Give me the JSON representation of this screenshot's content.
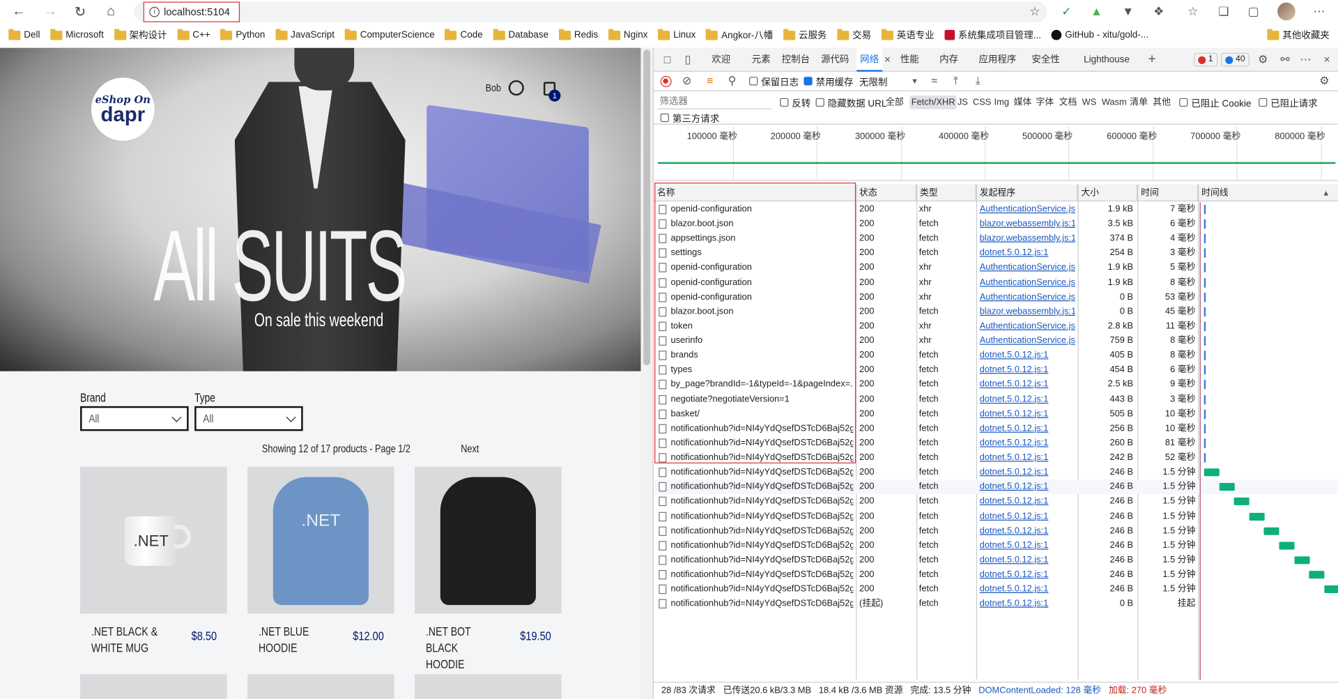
{
  "browser": {
    "url": "localhost:5104",
    "bookmarks": [
      "Dell",
      "Microsoft",
      "架构设计",
      "C++",
      "Python",
      "JavaScript",
      "ComputerScience",
      "Code",
      "Database",
      "Redis",
      "Nginx",
      "Linux",
      "Angkor-八幡",
      "云服务",
      "交易",
      "英语专业"
    ],
    "bookmark_special": "系统集成项目管理...",
    "bookmark_github": "GitHub - xitu/gold-...",
    "bookmark_other": "其他收藏夹"
  },
  "shop": {
    "logo_top": "eShop On",
    "logo_main": "dapr",
    "user": "Bob",
    "basket_count": "1",
    "hero_title": "All SUITS",
    "hero_subtitle": "On sale this weekend",
    "brand_label": "Brand",
    "brand_value": "All",
    "type_label": "Type",
    "type_value": "All",
    "showing": "Showing 12 of 17 products - Page 1/2",
    "next": "Next",
    "products": [
      {
        "name": ".NET BLACK & WHITE MUG",
        "price": "$8.50",
        "image_text": ".NET"
      },
      {
        "name": ".NET BLUE HOODIE",
        "price": "$12.00",
        "image_text": ".NET"
      },
      {
        "name": ".NET BOT BLACK HOODIE",
        "price": "$19.50",
        "image_text": ""
      }
    ]
  },
  "devtools": {
    "tabs": [
      "欢迎",
      "元素",
      "控制台",
      "源代码",
      "网络",
      "性能",
      "内存",
      "应用程序",
      "安全性",
      "Lighthouse"
    ],
    "active_tab": "网络",
    "error_count": "1",
    "message_count": "40",
    "preserve_log": "保留日志",
    "disable_cache": "禁用缓存",
    "throttle": "无限制",
    "filter_placeholder": "筛选器",
    "invert": "反转",
    "hide_data_urls": "隐藏数据 URL",
    "filter_types": [
      "全部",
      "Fetch/XHR",
      "JS",
      "CSS",
      "Img",
      "媒体",
      "字体",
      "文档",
      "WS",
      "Wasm",
      "清单",
      "其他"
    ],
    "active_filter": "Fetch/XHR",
    "blocked_cookies": "已阻止 Cookie",
    "blocked_requests": "已阻止请求",
    "third_party": "第三方请求",
    "overview_ticks": [
      "100000 毫秒",
      "200000 毫秒",
      "300000 毫秒",
      "400000 毫秒",
      "500000 毫秒",
      "600000 毫秒",
      "700000 毫秒",
      "800000 毫秒"
    ],
    "columns": [
      "名称",
      "状态",
      "类型",
      "发起程序",
      "大小",
      "时间",
      "时间线"
    ],
    "requests": [
      {
        "name": "openid-configuration",
        "status": "200",
        "type": "xhr",
        "initiator": "AuthenticationService.js:1",
        "size": "1.9 kB",
        "time": "7 毫秒"
      },
      {
        "name": "blazor.boot.json",
        "status": "200",
        "type": "fetch",
        "initiator": "blazor.webassembly.js:1",
        "size": "3.5 kB",
        "time": "6 毫秒"
      },
      {
        "name": "appsettings.json",
        "status": "200",
        "type": "fetch",
        "initiator": "blazor.webassembly.js:1",
        "size": "374 B",
        "time": "4 毫秒"
      },
      {
        "name": "settings",
        "status": "200",
        "type": "fetch",
        "initiator": "dotnet.5.0.12.js:1",
        "size": "254 B",
        "time": "3 毫秒"
      },
      {
        "name": "openid-configuration",
        "status": "200",
        "type": "xhr",
        "initiator": "AuthenticationService.js:1",
        "size": "1.9 kB",
        "time": "5 毫秒"
      },
      {
        "name": "openid-configuration",
        "status": "200",
        "type": "xhr",
        "initiator": "AuthenticationService.js:1",
        "size": "1.9 kB",
        "time": "8 毫秒"
      },
      {
        "name": "openid-configuration",
        "status": "200",
        "type": "xhr",
        "initiator": "AuthenticationService.js:1",
        "size": "0 B",
        "time": "53 毫秒"
      },
      {
        "name": "blazor.boot.json",
        "status": "200",
        "type": "fetch",
        "initiator": "blazor.webassembly.js:1",
        "size": "0 B",
        "time": "45 毫秒"
      },
      {
        "name": "token",
        "status": "200",
        "type": "xhr",
        "initiator": "AuthenticationService.js:1",
        "size": "2.8 kB",
        "time": "11 毫秒"
      },
      {
        "name": "userinfo",
        "status": "200",
        "type": "xhr",
        "initiator": "AuthenticationService.js:1",
        "size": "759 B",
        "time": "8 毫秒"
      },
      {
        "name": "brands",
        "status": "200",
        "type": "fetch",
        "initiator": "dotnet.5.0.12.js:1",
        "size": "405 B",
        "time": "8 毫秒"
      },
      {
        "name": "types",
        "status": "200",
        "type": "fetch",
        "initiator": "dotnet.5.0.12.js:1",
        "size": "454 B",
        "time": "6 毫秒"
      },
      {
        "name": "by_page?brandId=-1&typeId=-1&pageIndex=...",
        "status": "200",
        "type": "fetch",
        "initiator": "dotnet.5.0.12.js:1",
        "size": "2.5 kB",
        "time": "9 毫秒"
      },
      {
        "name": "negotiate?negotiateVersion=1",
        "status": "200",
        "type": "fetch",
        "initiator": "dotnet.5.0.12.js:1",
        "size": "443 B",
        "time": "3 毫秒"
      },
      {
        "name": "basket/",
        "status": "200",
        "type": "fetch",
        "initiator": "dotnet.5.0.12.js:1",
        "size": "505 B",
        "time": "10 毫秒"
      },
      {
        "name": "notificationhub?id=NI4yYdQsefDSTcD6Baj52g",
        "status": "200",
        "type": "fetch",
        "initiator": "dotnet.5.0.12.js:1",
        "size": "256 B",
        "time": "10 毫秒"
      },
      {
        "name": "notificationhub?id=NI4yYdQsefDSTcD6Baj52g",
        "status": "200",
        "type": "fetch",
        "initiator": "dotnet.5.0.12.js:1",
        "size": "260 B",
        "time": "81 毫秒"
      },
      {
        "name": "notificationhub?id=NI4yYdQsefDSTcD6Baj52g",
        "status": "200",
        "type": "fetch",
        "initiator": "dotnet.5.0.12.js:1",
        "size": "242 B",
        "time": "52 毫秒"
      },
      {
        "name": "notificationhub?id=NI4yYdQsefDSTcD6Baj52g",
        "status": "200",
        "type": "fetch",
        "initiator": "dotnet.5.0.12.js:1",
        "size": "246 B",
        "time": "1.5 分钟"
      },
      {
        "name": "notificationhub?id=NI4yYdQsefDSTcD6Baj52g",
        "status": "200",
        "type": "fetch",
        "initiator": "dotnet.5.0.12.js:1",
        "size": "246 B",
        "time": "1.5 分钟"
      },
      {
        "name": "notificationhub?id=NI4yYdQsefDSTcD6Baj52g",
        "status": "200",
        "type": "fetch",
        "initiator": "dotnet.5.0.12.js:1",
        "size": "246 B",
        "time": "1.5 分钟"
      },
      {
        "name": "notificationhub?id=NI4yYdQsefDSTcD6Baj52g",
        "status": "200",
        "type": "fetch",
        "initiator": "dotnet.5.0.12.js:1",
        "size": "246 B",
        "time": "1.5 分钟"
      },
      {
        "name": "notificationhub?id=NI4yYdQsefDSTcD6Baj52g",
        "status": "200",
        "type": "fetch",
        "initiator": "dotnet.5.0.12.js:1",
        "size": "246 B",
        "time": "1.5 分钟"
      },
      {
        "name": "notificationhub?id=NI4yYdQsefDSTcD6Baj52g",
        "status": "200",
        "type": "fetch",
        "initiator": "dotnet.5.0.12.js:1",
        "size": "246 B",
        "time": "1.5 分钟"
      },
      {
        "name": "notificationhub?id=NI4yYdQsefDSTcD6Baj52g",
        "status": "200",
        "type": "fetch",
        "initiator": "dotnet.5.0.12.js:1",
        "size": "246 B",
        "time": "1.5 分钟"
      },
      {
        "name": "notificationhub?id=NI4yYdQsefDSTcD6Baj52g",
        "status": "200",
        "type": "fetch",
        "initiator": "dotnet.5.0.12.js:1",
        "size": "246 B",
        "time": "1.5 分钟"
      },
      {
        "name": "notificationhub?id=NI4yYdQsefDSTcD6Baj52g",
        "status": "200",
        "type": "fetch",
        "initiator": "dotnet.5.0.12.js:1",
        "size": "246 B",
        "time": "1.5 分钟"
      },
      {
        "name": "notificationhub?id=NI4yYdQsefDSTcD6Baj52g",
        "status": "(挂起)",
        "type": "fetch",
        "initiator": "dotnet.5.0.12.js:1",
        "size": "0 B",
        "time": "挂起"
      }
    ],
    "status": {
      "requests": "28 /83 次请求",
      "transferred": "已传送20.6 kB/3.3 MB",
      "resources": "18.4 kB /3.6 MB 资源",
      "finish": "完成: 13.5 分钟",
      "dcl_label": "DOMContentLoaded:",
      "dcl_value": "128 毫秒",
      "load_label": "加载:",
      "load_value": "270 毫秒"
    }
  },
  "colors": {
    "accent": "#1a73e8",
    "brand": "#00166b",
    "highlight_border": "#e0303a",
    "waterfall_green": "#0eb07a"
  }
}
